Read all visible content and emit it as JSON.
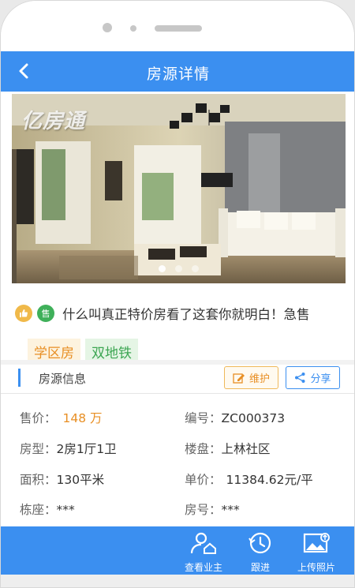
{
  "header": {
    "title": "房源详情"
  },
  "gallery": {
    "watermark": "亿房通",
    "page_count": 3,
    "active_page": 1
  },
  "headline": {
    "sale_badge": "售",
    "text": "什么叫真正特价房看了这套你就明白！急售"
  },
  "tags": [
    "学区房",
    "双地铁"
  ],
  "section": {
    "title": "房源信息",
    "maintain_label": "维护",
    "share_label": "分享"
  },
  "info": {
    "price_label": "售价：",
    "price_value": "148 万",
    "code_label": "编号：",
    "code_value": "ZC000373",
    "layout_label": "房型：",
    "layout_value": "2房1厅1卫",
    "estate_label": "楼盘：",
    "estate_value": "上林社区",
    "area_label": "面积：",
    "area_value": "130平米",
    "unit_label": "单价：",
    "unit_value": "11384.62元/平",
    "building_label": "栋座：",
    "building_value": "***",
    "room_label": "房号：",
    "room_value": "***"
  },
  "actions": {
    "view_owner": "查看业主",
    "follow_up": "跟进",
    "upload_photo": "上传照片"
  },
  "colors": {
    "primary": "#3b8ff0",
    "orange": "#e88f24",
    "green": "#3da653"
  }
}
